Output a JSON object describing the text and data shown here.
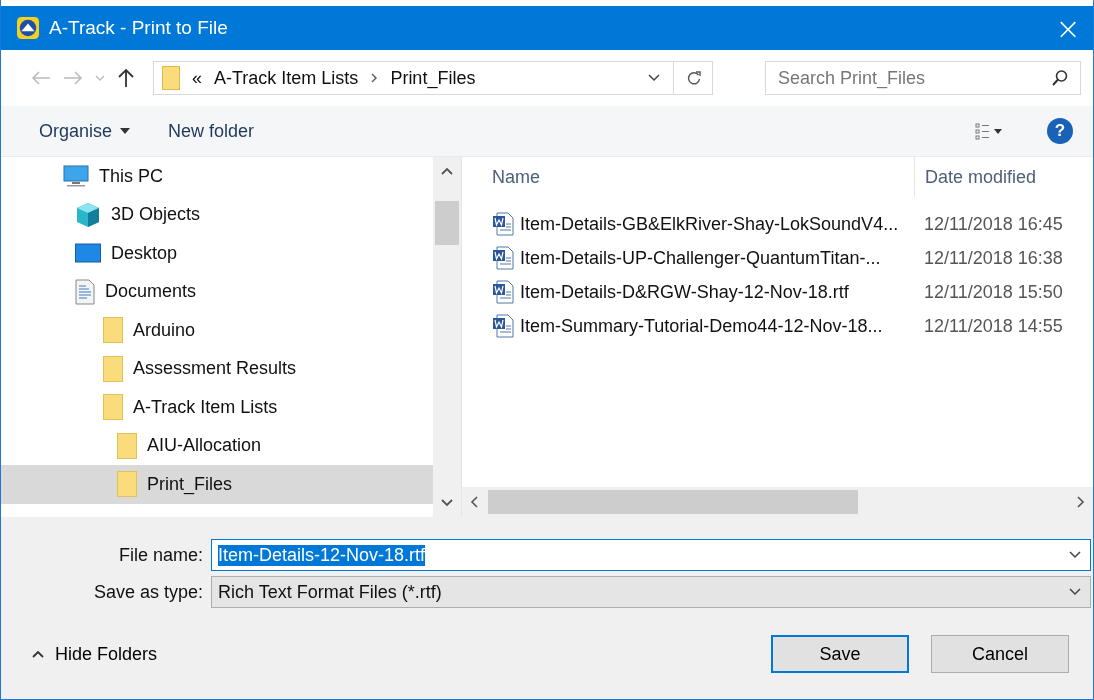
{
  "window": {
    "title": "A-Track - Print to File",
    "close": "×"
  },
  "address_bar": {
    "overflow": "«",
    "path": [
      "A-Track Item Lists",
      "Print_Files"
    ]
  },
  "search": {
    "placeholder": "Search Print_Files"
  },
  "toolbar": {
    "organise": "Organise",
    "new_folder": "New folder",
    "help": "?"
  },
  "tree": [
    {
      "label": "This PC",
      "kind": "pc",
      "selected": false,
      "children": [
        {
          "label": "3D Objects",
          "kind": "cube",
          "selected": false
        },
        {
          "label": "Desktop",
          "kind": "desktop",
          "selected": false
        },
        {
          "label": "Documents",
          "kind": "documents",
          "selected": false,
          "children": [
            {
              "label": "Arduino",
              "kind": "folder",
              "selected": false
            },
            {
              "label": "Assessment Results",
              "kind": "folder",
              "selected": false
            },
            {
              "label": "A-Track Item Lists",
              "kind": "folder",
              "selected": false,
              "children": [
                {
                  "label": "AIU-Allocation",
                  "kind": "folder",
                  "selected": false
                },
                {
                  "label": "Print_Files",
                  "kind": "folder",
                  "selected": true
                }
              ]
            }
          ]
        }
      ]
    }
  ],
  "file_list": {
    "columns": [
      "Name",
      "Date modified"
    ],
    "rows": [
      {
        "name": "Item-Details-GB&ElkRiver-Shay-LokSoundV4...",
        "date": "12/11/2018 16:45"
      },
      {
        "name": "Item-Details-UP-Challenger-QuantumTitan-...",
        "date": "12/11/2018 16:38"
      },
      {
        "name": "Item-Details-D&RGW-Shay-12-Nov-18.rtf",
        "date": "12/11/2018 15:50"
      },
      {
        "name": "Item-Summary-Tutorial-Demo44-12-Nov-18...",
        "date": "12/11/2018 14:55"
      }
    ]
  },
  "file_name": {
    "label": "File name:",
    "value": "Item-Details-12-Nov-18.rtf"
  },
  "save_as_type": {
    "label": "Save as type:",
    "value": "Rich Text Format Files (*.rtf)"
  },
  "hide_folders": "Hide Folders",
  "buttons": [
    {
      "label": "Save",
      "kind": "default"
    },
    {
      "label": "Cancel",
      "kind": "normal"
    }
  ]
}
